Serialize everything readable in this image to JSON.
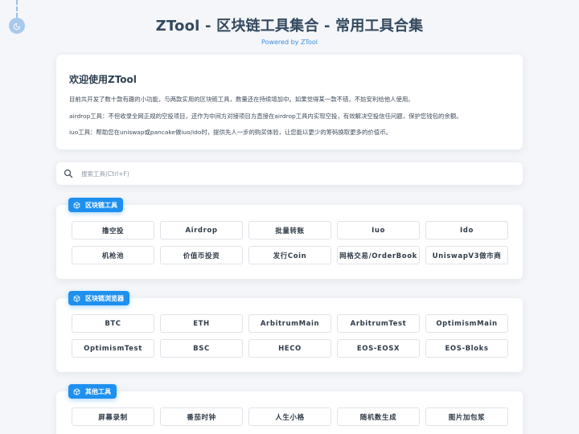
{
  "header": {
    "title": "ZTool - 区块链工具集合 - 常用工具合集",
    "subtitle": "Powered by ZTool"
  },
  "theme_toggle": {
    "icon": "moon-icon"
  },
  "intro": {
    "title": "欢迎使用ZTool",
    "paragraphs": [
      "目前共开发了数十款有趣的小功能，与两款实用的区块链工具，数量还在持续增加中。如果觉得某一款不错，不妨安利给他人使用。",
      "airdrop工具：不但收录全网正规的空投项目，还作为中间方对接项目方直接在airdrop工具内实现空投，有效解决空投信任问题，保护您钱包的余额。",
      "iuo工具：帮助您在uniswap或pancake做iuo/ido时，提供先人一步的购买体验，让您能以更少的筹码换取更多的价值币。"
    ]
  },
  "search": {
    "placeholder": "搜索工具(Ctrl+F)",
    "value": "",
    "icon": "search-icon"
  },
  "sections": [
    {
      "title": "区块链工具",
      "icon": "cube-icon",
      "items": [
        "撸空投",
        "Airdrop",
        "批量转账",
        "Iuo",
        "Ido",
        "机枪池",
        "价值币投资",
        "发行Coin",
        "网格交易/OrderBook",
        "UniswapV3做市商"
      ]
    },
    {
      "title": "区块链浏览器",
      "icon": "cube-icon",
      "items": [
        "BTC",
        "ETH",
        "ArbitrumMain",
        "ArbitrumTest",
        "OptimismMain",
        "OptimismTest",
        "BSC",
        "HECO",
        "EOS-EOSX",
        "EOS-Bloks"
      ]
    },
    {
      "title": "其他工具",
      "icon": "cube-icon",
      "items": [
        "屏幕录制",
        "番茄时钟",
        "人生小格",
        "随机数生成",
        "图片加包浆"
      ]
    }
  ],
  "colors": {
    "accent": "#1e90f0",
    "background": "#f4f6f9",
    "title": "#34495e",
    "subtitle": "#3a8ee6"
  }
}
